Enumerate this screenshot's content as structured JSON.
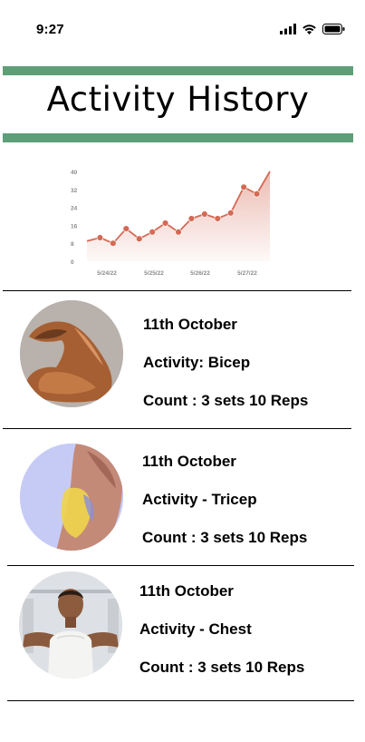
{
  "status_bar": {
    "time": "9:27",
    "icons": [
      "signal-icon",
      "wifi-icon",
      "battery-icon"
    ]
  },
  "header": {
    "title": "Activity History",
    "accent_color": "#5f9f78"
  },
  "chart_data": {
    "type": "line",
    "x": [
      "5/24/22",
      "5/24/22",
      "5/24/22",
      "5/24/22",
      "5/24/22",
      "5/25/22",
      "5/25/22",
      "5/25/22",
      "5/25/22",
      "5/26/22",
      "5/26/22",
      "5/26/22",
      "5/27/22",
      "5/27/22",
      "5/27/22"
    ],
    "series": [
      {
        "values": [
          9,
          10.5,
          8,
          14.5,
          10,
          13,
          17,
          13,
          19,
          21,
          19,
          21.5,
          33,
          30,
          40
        ]
      }
    ],
    "xticks": [
      "5/24/22",
      "5/25/22",
      "5/26/22",
      "5/27/22"
    ],
    "yticks": [
      0,
      8,
      16,
      24,
      32,
      40
    ],
    "ylim": [
      0,
      40
    ],
    "fill": "area",
    "color": "#d46a55"
  },
  "activities": [
    {
      "date": "11th October",
      "activity": "Activity: Bicep",
      "count": "Count : 3 sets 10 Reps"
    },
    {
      "date": "11th October",
      "activity": "Activity - Tricep",
      "count": "Count : 3 sets 10 Reps"
    },
    {
      "date": "11th October",
      "activity": "Activity - Chest",
      "count": "Count : 3 sets 10 Reps"
    }
  ]
}
